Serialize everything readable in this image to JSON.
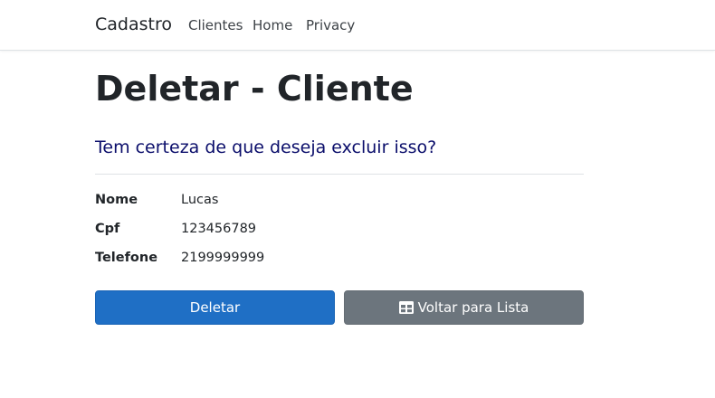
{
  "navbar": {
    "brand": "Cadastro",
    "links": [
      "Clientes",
      "Home",
      "Privacy"
    ]
  },
  "page": {
    "title": "Deletar - Cliente",
    "question": "Tem certeza de que deseja excluir isso?"
  },
  "details": [
    {
      "label": "Nome",
      "value": "Lucas"
    },
    {
      "label": "Cpf",
      "value": "123456789"
    },
    {
      "label": "Telefone",
      "value": "2199999999"
    }
  ],
  "actions": {
    "delete_label": "Deletar",
    "back_label": "Voltar para Lista",
    "back_icon": "table-icon"
  },
  "colors": {
    "primary": "#1f6fc5",
    "secondary": "#6c757d",
    "question": "#0b0e6b"
  }
}
